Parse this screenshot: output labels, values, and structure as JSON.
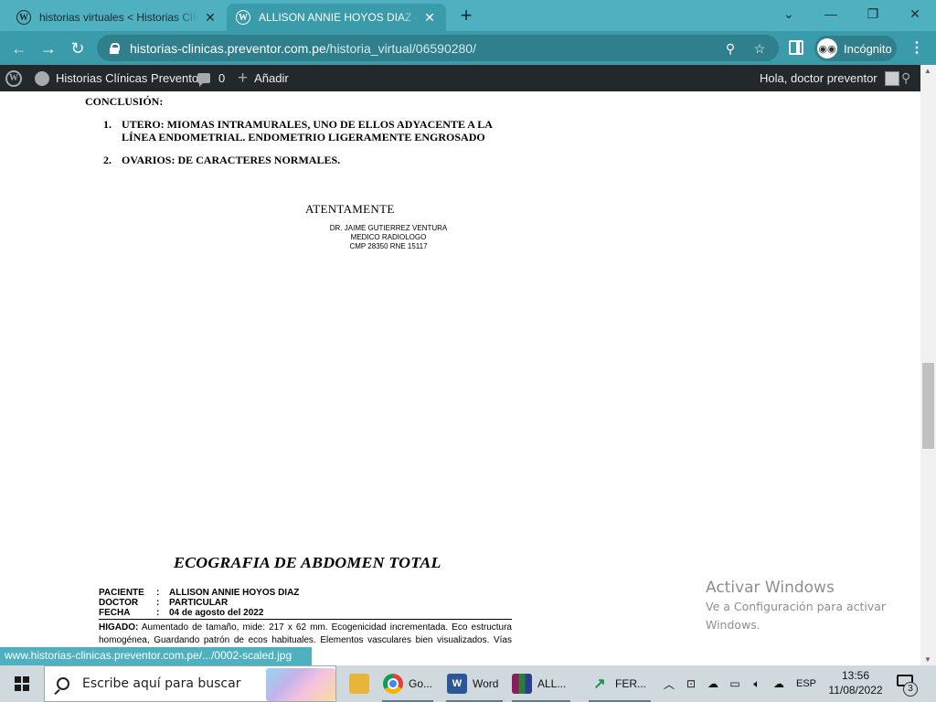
{
  "browser": {
    "tabs": [
      {
        "title": "historias virtuales < Historias Clínicas Preventor",
        "active": false
      },
      {
        "title": "ALLISON ANNIE HOYOS DIAZ – Historias Clínicas Preventor",
        "active": true
      }
    ],
    "new_tab_symbol": "+",
    "url_host": "historias-clinicas.preventor.com.pe",
    "url_path": "/historia_virtual/06590280/",
    "incognito_label": "Incógnito",
    "theme_color": "#4fb0c0"
  },
  "adminbar": {
    "site_name": "Historias Clínicas Preventor",
    "comments_count": "0",
    "new_label": "Añadir",
    "greeting": "Hola, doctor preventor"
  },
  "report": {
    "conclusion_heading": "CONCLUSIÓN:",
    "items": [
      {
        "num": "1.",
        "text": "UTERO: MIOMAS INTRAMURALES, UNO DE ELLOS ADYACENTE A LA LÍNEA ENDOMETRIAL. ENDOMETRIO LIGERAMENTE ENGROSADO"
      },
      {
        "num": "2.",
        "text": "OVARIOS: DE CARACTERES  NORMALES."
      }
    ],
    "closing": "ATENTAMENTE",
    "signature": [
      "DR. JAIME GUTIERREZ VENTURA",
      "MEDICO RADIOLOGO",
      "CMP  28350   RNE 15117"
    ]
  },
  "report2": {
    "title": "ECOGRAFIA DE ABDOMEN TOTAL",
    "meta": [
      {
        "key": "PACIENTE",
        "value": "ALLISON ANNIE HOYOS DIAZ"
      },
      {
        "key": "DOCTOR",
        "value": "PARTICULAR"
      },
      {
        "key": "FECHA",
        "value": "04 de agosto del 2022"
      }
    ],
    "colon": ":",
    "para_label": "HIGADO:",
    "para_text": " Aumentado de tamaño, mide: 217 x 62 mm.  Ecogenicidad incrementada. Eco estructura homogénea, Guardando patrón de ecos habituales. Elementos vasculares bien visualizados. Vías intrahepáticas no dilatadas. No lesiones"
  },
  "watermark": {
    "line1": "Activar Windows",
    "line2": "Ve a Configuración para activar Windows."
  },
  "status_url": "www.historias-clinicas.preventor.com.pe/.../0002-scaled.jpg",
  "taskbar": {
    "search_placeholder": "Escribe aquí para buscar",
    "apps": [
      {
        "name": "files",
        "label": ""
      },
      {
        "name": "chrome",
        "label": "Go..."
      },
      {
        "name": "word",
        "label": "Word"
      },
      {
        "name": "winrar",
        "label": "ALL..."
      },
      {
        "name": "fer",
        "label": "FER..."
      }
    ],
    "language": "ESP",
    "time": "13:56",
    "date": "11/08/2022",
    "notifications": "3"
  }
}
